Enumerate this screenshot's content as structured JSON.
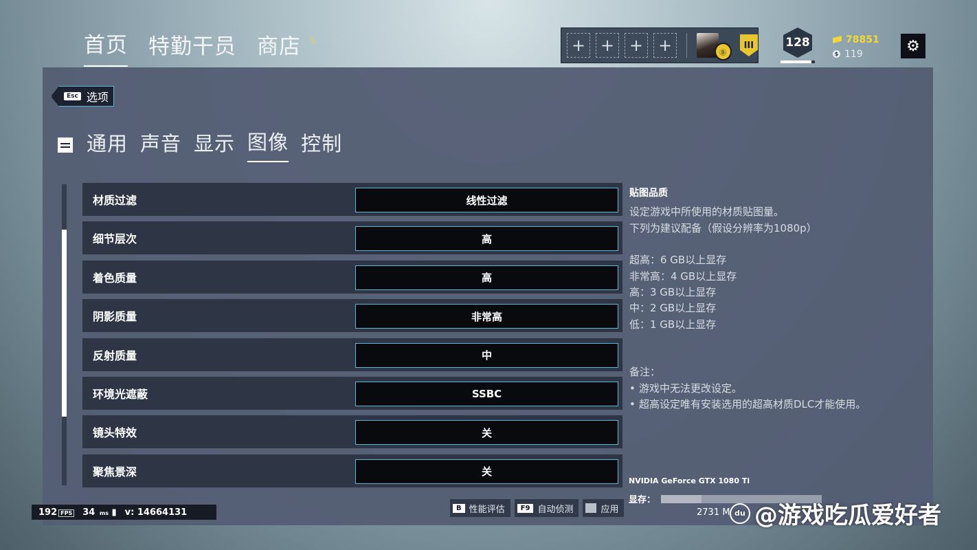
{
  "top_nav": {
    "tabs": [
      "首页",
      "特勤干员",
      "商店"
    ],
    "active": "首页",
    "store_badge": "¼"
  },
  "squad": {
    "slots": [
      "+",
      "+",
      "+",
      "+"
    ],
    "rank_badge": "Ⓑ",
    "shield_label": "III"
  },
  "player": {
    "level": "128",
    "level_progress": 0.9,
    "renown": "78851",
    "credits": "119",
    "credit_icon": "$"
  },
  "settings_icon": "⚙",
  "back": {
    "key": "Esc",
    "label": "选项"
  },
  "categories": [
    "通用",
    "声音",
    "显示",
    "图像",
    "控制"
  ],
  "active_category": "图像",
  "settings": [
    {
      "label": "材质过滤",
      "value": "线性过滤"
    },
    {
      "label": "细节层次",
      "value": "高"
    },
    {
      "label": "着色质量",
      "value": "高"
    },
    {
      "label": "阴影质量",
      "value": "非常高"
    },
    {
      "label": "反射质量",
      "value": "中"
    },
    {
      "label": "环境光遮蔽",
      "value": "SSBC"
    },
    {
      "label": "镜头特效",
      "value": "关"
    },
    {
      "label": "聚焦景深",
      "value": "关"
    }
  ],
  "info": {
    "title": "贴图品质",
    "line1": "设定游戏中所使用的材质贴图量。",
    "line2": "下列为建议配备（假设分辨率为1080p）",
    "req1": "超高：6 GB以上显存",
    "req2": "非常高：4 GB以上显存",
    "req3": "高：3 GB以上显存",
    "req4": "中：2 GB以上显存",
    "req5": "低：1 GB以上显存",
    "note_title": "备注：",
    "note1": "游戏中无法更改设定。",
    "note2": "超高设定唯有安装选用的超高材质DLC才能使用。"
  },
  "gpu": {
    "name": "NVIDIA GeForce GTX 1080 Ti",
    "vram_label": "显存：",
    "vram_fraction": 0.25,
    "vram_text": "2731 M"
  },
  "stats": {
    "fps": "192",
    "fps_tag": "FPS",
    "ping": "34",
    "ping_unit": "ms",
    "version": "v: 14664131"
  },
  "buttons": [
    {
      "key": "B",
      "label": "性能评估"
    },
    {
      "key": "F9",
      "label": "自动侦测"
    },
    {
      "key": "",
      "label": "应用"
    }
  ],
  "watermark": {
    "logo": "du",
    "text": "@游戏吃瓜爱好者"
  }
}
